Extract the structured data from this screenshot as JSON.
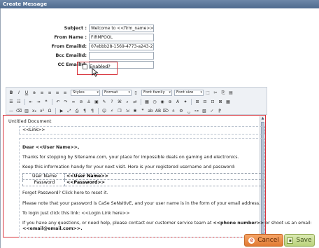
{
  "window": {
    "title": "Create Message"
  },
  "form": {
    "subject": {
      "label": "Subject :",
      "value": "Welcome to <<firm_name>>"
    },
    "from_name": {
      "label": "From Name :",
      "value": "FIRMPOOL"
    },
    "from_emailid": {
      "label": "From EmailId:",
      "value": "07ebbb28-1569-4773-a243-252e"
    },
    "bcc_emailid": {
      "label": "Bcc EmailId:",
      "value": ""
    },
    "cc_emailid": {
      "label": "CC EmailId:",
      "value": ""
    },
    "enabled": {
      "label": "Enabled?",
      "checked": false
    }
  },
  "toolbar": {
    "styles": "Styles",
    "format": "Format",
    "font_family": "Font family",
    "font_size": "Font size"
  },
  "editor": {
    "doc_title": "Untitled Document",
    "link_placeholder": "<<Link>>",
    "greeting": "Dear <<User Name>>,",
    "thanks": "Thanks for stopping by Sitename.com, your place for impossible deals on gaming and electronics.",
    "keep_info": "Keep this information handy for your next visit. Here is your registered username and password:",
    "credentials": [
      {
        "label": "User Name",
        "value": "<<User Name>>"
      },
      {
        "label": "Password",
        "value": "<<Password>>"
      }
    ],
    "forgot": "Forgot Password? Click here to reset it.",
    "case_note": "Please note that your password is CaSe SeNsItIvE, and your user name is in the form of your email address.",
    "login_prefix": "To login just click this link: ",
    "login_link": "<<Login Link here>>",
    "contact_prefix": "If you have any questions, or need help, please contact our customer service team at ",
    "phone": "<<phone number>>",
    "contact_mid": " or shoot us an email:",
    "email": "<<email@email.com>>."
  },
  "buttons": {
    "cancel": "Cancel",
    "save": "Save"
  },
  "colors": {
    "highlight": "#d8333b",
    "cancel": "#e07a33",
    "save": "#b9d27a"
  }
}
